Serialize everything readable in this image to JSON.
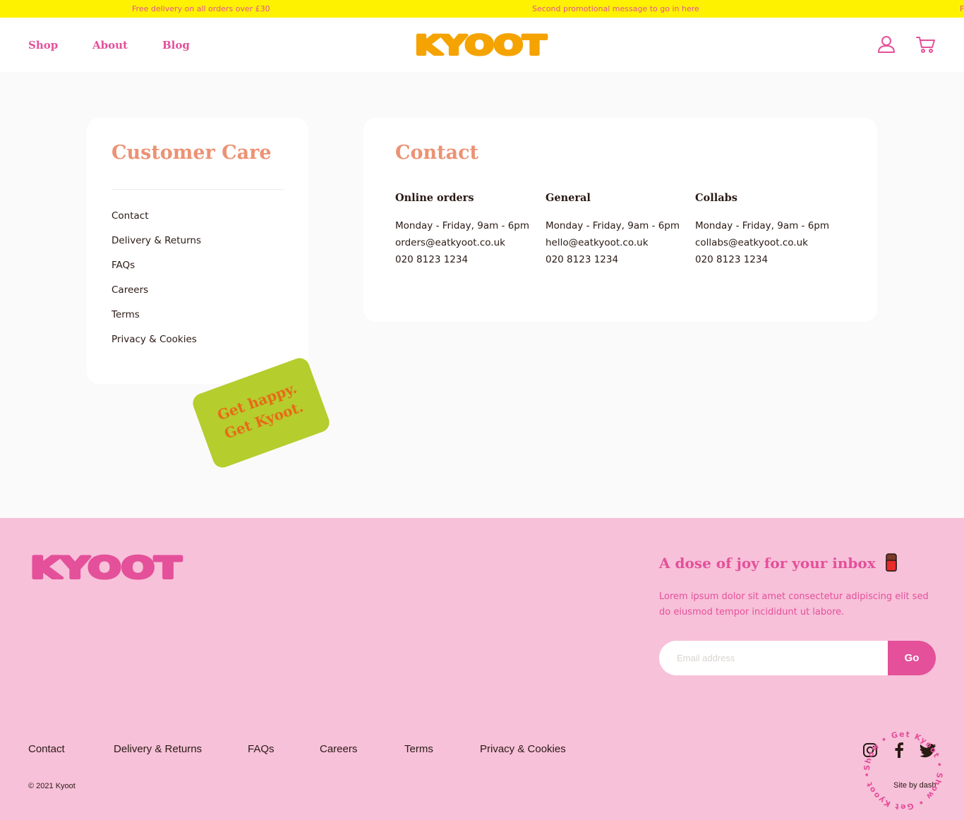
{
  "promo": {
    "message_1": "Free delivery on all orders over £30",
    "message_2": "Second promotional message to go in here",
    "message_3": "F"
  },
  "nav": {
    "items": [
      {
        "label": "Shop"
      },
      {
        "label": "About"
      },
      {
        "label": "Blog"
      }
    ],
    "logo_text": "KYOOT",
    "account_icon": "user-icon",
    "cart_icon": "cart-icon"
  },
  "customer_care": {
    "title": "Customer Care",
    "links": [
      {
        "label": "Contact"
      },
      {
        "label": "Delivery & Returns"
      },
      {
        "label": "FAQs"
      },
      {
        "label": "Careers"
      },
      {
        "label": "Terms"
      },
      {
        "label": "Privacy & Cookies"
      }
    ]
  },
  "contact": {
    "title": "Contact",
    "columns": [
      {
        "title": "Online orders",
        "hours": "Monday - Friday, 9am - 6pm",
        "email": "orders@eatkyoot.co.uk",
        "phone": "020 8123 1234"
      },
      {
        "title": "General",
        "hours": "Monday - Friday, 9am - 6pm",
        "email": "hello@eatkyoot.co.uk",
        "phone": "020 8123 1234"
      },
      {
        "title": "Collabs",
        "hours": "Monday - Friday, 9am - 6pm",
        "email": "collabs@eatkyoot.co.uk",
        "phone": "020 8123 1234"
      }
    ]
  },
  "sticker": {
    "line_1": "Get happy.",
    "line_2": "Get Kyoot."
  },
  "footer": {
    "logo_text": "KYOOT",
    "newsletter": {
      "title": "A dose of joy for your inbox",
      "body": "Lorem ipsum dolor sit amet consectetur adipiscing elit sed do eiusmod tempor incididunt ut labore.",
      "email_placeholder": "Email address",
      "button_label": "Go"
    },
    "links": [
      {
        "label": "Contact"
      },
      {
        "label": "Delivery & Returns"
      },
      {
        "label": "FAQs"
      },
      {
        "label": "Careers"
      },
      {
        "label": "Terms"
      },
      {
        "label": "Privacy & Cookies"
      }
    ],
    "copyright": "© 2021 Kyoot",
    "site_by": "Site by dash",
    "social_icons": [
      "instagram-icon",
      "facebook-icon",
      "twitter-icon"
    ],
    "badge_text": "Show • Get Kyoot • Show • Get Kyoot •"
  },
  "colors": {
    "pink": "#e4509a",
    "yellow": "#fff200",
    "orange_logo": "#f5a300",
    "salmon": "#ec9274",
    "footer_bg": "#f7c1d9",
    "sticker_green": "#b5cd2d",
    "sticker_text": "#e86a18"
  }
}
